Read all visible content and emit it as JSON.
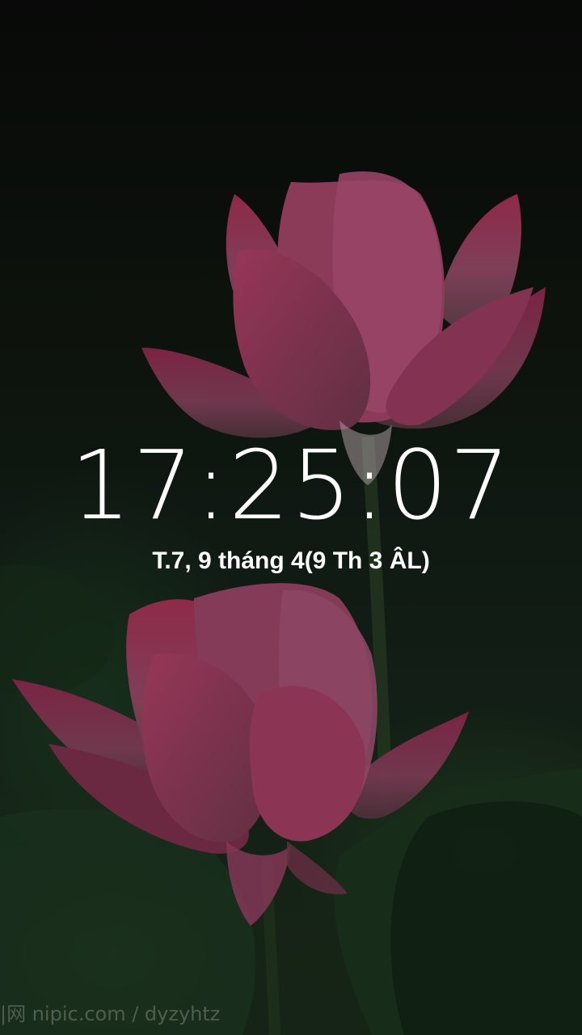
{
  "lockscreen": {
    "time": "17:25:07",
    "date": "T.7, 9 tháng 4(9 Th 3 ÂL)"
  },
  "wallpaper": {
    "subject": "lotus-flowers",
    "watermark": "|网 nipic.com / dyzyhtz"
  },
  "colors": {
    "text": "#ffffff",
    "petal": "#c7496f",
    "petal_light": "#e8a8bc",
    "leaf": "#223f24"
  }
}
